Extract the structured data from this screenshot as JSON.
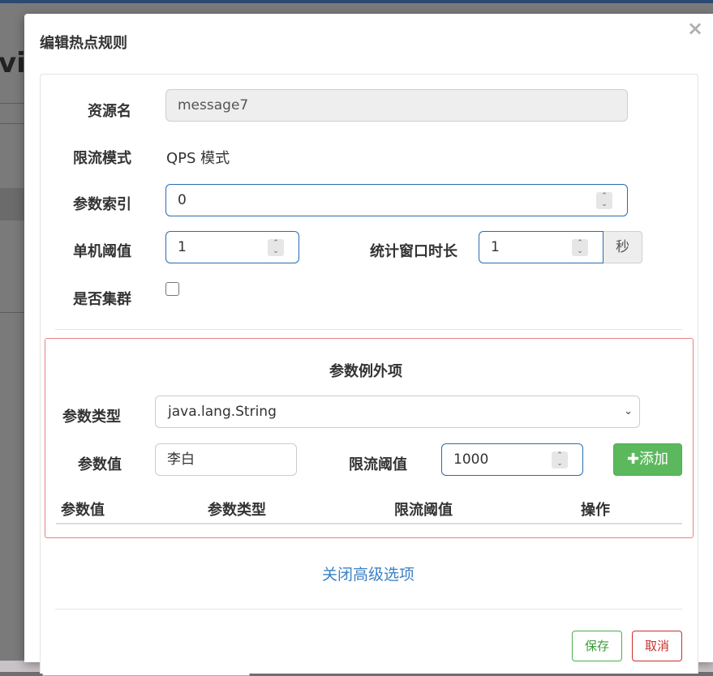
{
  "background": {
    "title_fragment": "vic"
  },
  "modal": {
    "title": "编辑热点规则",
    "close_symbol": "×"
  },
  "form": {
    "resource": {
      "label": "资源名",
      "value": "message7"
    },
    "mode": {
      "label": "限流模式",
      "value": "QPS 模式"
    },
    "param_index": {
      "label": "参数索引",
      "value": "0"
    },
    "threshold": {
      "label": "单机阈值",
      "value": "1"
    },
    "window": {
      "label": "统计窗口时长",
      "value": "1",
      "unit": "秒"
    },
    "cluster": {
      "label": "是否集群",
      "checked": false
    }
  },
  "exceptions": {
    "title": "参数例外项",
    "param_type": {
      "label": "参数类型",
      "selected": "java.lang.String"
    },
    "param_value": {
      "label": "参数值",
      "value": "李白"
    },
    "limit": {
      "label": "限流阈值",
      "value": "1000"
    },
    "add_label": "添加",
    "table_headers": [
      "参数值",
      "参数类型",
      "限流阈值",
      "操作"
    ]
  },
  "advanced_link": "关闭高级选项",
  "footer": {
    "save_label": "保存",
    "cancel_label": "取消"
  },
  "colors": {
    "primary_border": "#2a6cb0",
    "success": "#5cb85c",
    "danger": "#c9302c",
    "exception_border": "#e9827e",
    "link": "#3b82c4"
  }
}
